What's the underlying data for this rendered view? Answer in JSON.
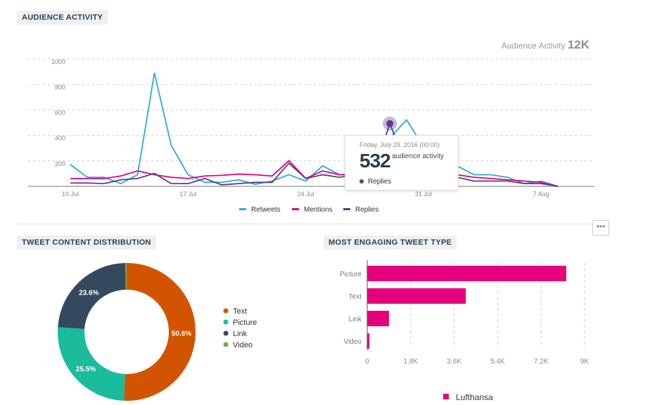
{
  "sections": {
    "activity": "AUDIENCE ACTIVITY",
    "distribution": "TWEET CONTENT DISTRIBUTION",
    "engaging": "MOST ENGAGING TWEET TYPE"
  },
  "summary": {
    "label": "Audience Activity",
    "value": "12K"
  },
  "tooltip": {
    "date": "Friday, July 29, 2016 (00:00)",
    "value": "532",
    "unit": "audience activity",
    "series": "Replies"
  },
  "more_button": "•••",
  "chart_data": [
    {
      "type": "line",
      "x": [
        "Jul 10",
        "Jul 11",
        "Jul 12",
        "Jul 13",
        "Jul 14",
        "Jul 15",
        "Jul 16",
        "Jul 17",
        "Jul 18",
        "Jul 19",
        "Jul 20",
        "Jul 21",
        "Jul 22",
        "Jul 23",
        "Jul 24",
        "Jul 25",
        "Jul 26",
        "Jul 27",
        "Jul 28",
        "Jul 29",
        "Jul 30",
        "Jul 31",
        "Aug 1",
        "Aug 2",
        "Aug 3",
        "Aug 4",
        "Aug 5",
        "Aug 6",
        "Aug 7",
        "Aug 8"
      ],
      "xticks": [
        {
          "label": "10 Jul",
          "index": 0
        },
        {
          "label": "17 Jul",
          "index": 7
        },
        {
          "label": "24 Jul",
          "index": 14
        },
        {
          "label": "31 Jul",
          "index": 21
        },
        {
          "label": "7 Aug",
          "index": 28
        }
      ],
      "yticks": [
        "200",
        "400",
        "600",
        "800",
        "1000"
      ],
      "ylim": [
        0,
        1000
      ],
      "grid": true,
      "legend": "bottom",
      "series": [
        {
          "name": "Retweets",
          "color": "#29aae1",
          "values": [
            210,
            110,
            110,
            60,
            130,
            930,
            360,
            130,
            70,
            70,
            90,
            55,
            80,
            130,
            80,
            200,
            130,
            140,
            180,
            420,
            560,
            350,
            250,
            200,
            130,
            130,
            110,
            60,
            80,
            10
          ]
        },
        {
          "name": "Mentions",
          "color": "#e6007e",
          "values": [
            100,
            100,
            100,
            120,
            160,
            130,
            110,
            100,
            120,
            125,
            135,
            130,
            120,
            240,
            100,
            160,
            130,
            130,
            150,
            140,
            150,
            150,
            180,
            130,
            110,
            100,
            90,
            80,
            70,
            15
          ]
        },
        {
          "name": "Replies",
          "color": "#5a3d8a",
          "values": [
            65,
            65,
            60,
            90,
            100,
            140,
            60,
            60,
            100,
            50,
            60,
            70,
            70,
            220,
            100,
            130,
            110,
            130,
            120,
            532,
            200,
            100,
            90,
            110,
            80,
            80,
            80,
            60,
            60,
            10
          ]
        }
      ]
    },
    {
      "type": "pie",
      "donut": true,
      "slices": [
        {
          "label": "Text",
          "value": 50.6,
          "display": "50.6%",
          "color": "#d35400"
        },
        {
          "label": "Picture",
          "value": 25.5,
          "display": "25.5%",
          "color": "#1abc9c"
        },
        {
          "label": "Link",
          "value": 23.6,
          "display": "23.6%",
          "color": "#34495e"
        },
        {
          "label": "Video",
          "value": 0.3,
          "display": "",
          "color": "#6ab04c"
        }
      ],
      "legend": "right"
    },
    {
      "type": "bar",
      "orientation": "horizontal",
      "categories": [
        "Picture",
        "Text",
        "Link",
        "Video"
      ],
      "series": [
        {
          "name": "Lufthansa",
          "color": "#e6007e",
          "values": [
            8240,
            4080,
            900,
            90
          ]
        }
      ],
      "xticks": [
        "0",
        "1.8K",
        "3.6K",
        "5.4K",
        "7.2K",
        "9K"
      ],
      "xlim": [
        0,
        9000
      ],
      "grid": true,
      "legend": "bottom"
    }
  ]
}
